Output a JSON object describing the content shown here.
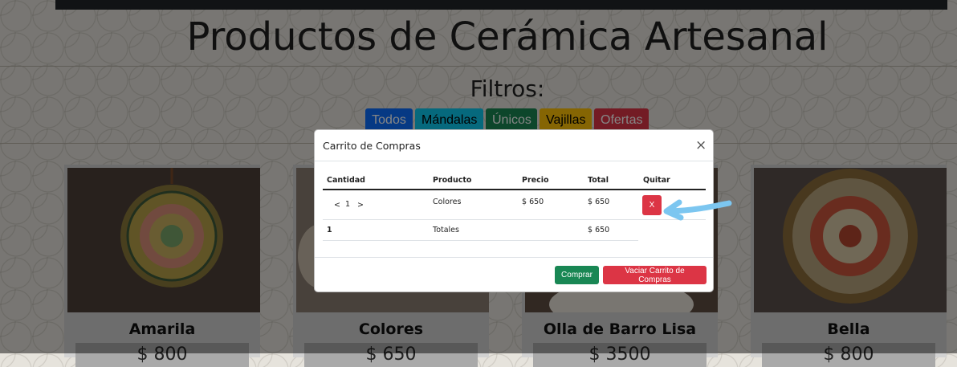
{
  "page": {
    "title": "Productos de Cerámica Artesanal"
  },
  "filters": {
    "title": "Filtros:",
    "buttons": [
      "Todos",
      "Mándalas",
      "Únicos",
      "Vajillas",
      "Ofertas"
    ]
  },
  "products": [
    {
      "name": "Amarila",
      "price": "$ 800"
    },
    {
      "name": "Colores",
      "price": "$ 650"
    },
    {
      "name": "Olla de Barro Lisa",
      "price": "$ 3500"
    },
    {
      "name": "Bella",
      "price": "$ 800"
    }
  ],
  "cart": {
    "title": "Carrito de Compras",
    "close": "×",
    "headers": [
      "Cantidad",
      "Producto",
      "Precio",
      "Total",
      "Quitar"
    ],
    "items": [
      {
        "qty_dec": "<",
        "qty": "1",
        "qty_inc": ">",
        "product": "Colores",
        "price": "$ 650",
        "total": "$ 650",
        "remove": "X"
      }
    ],
    "totals": {
      "qty": "1",
      "label": "Totales",
      "total": "$ 650"
    },
    "buy_label": "Comprar",
    "empty_label": "Vaciar Carrito de Compras"
  },
  "colors": {
    "primary": "#0d6efd",
    "info": "#0dcaf0",
    "success": "#198754",
    "warning": "#ffc107",
    "danger": "#dc3545"
  }
}
